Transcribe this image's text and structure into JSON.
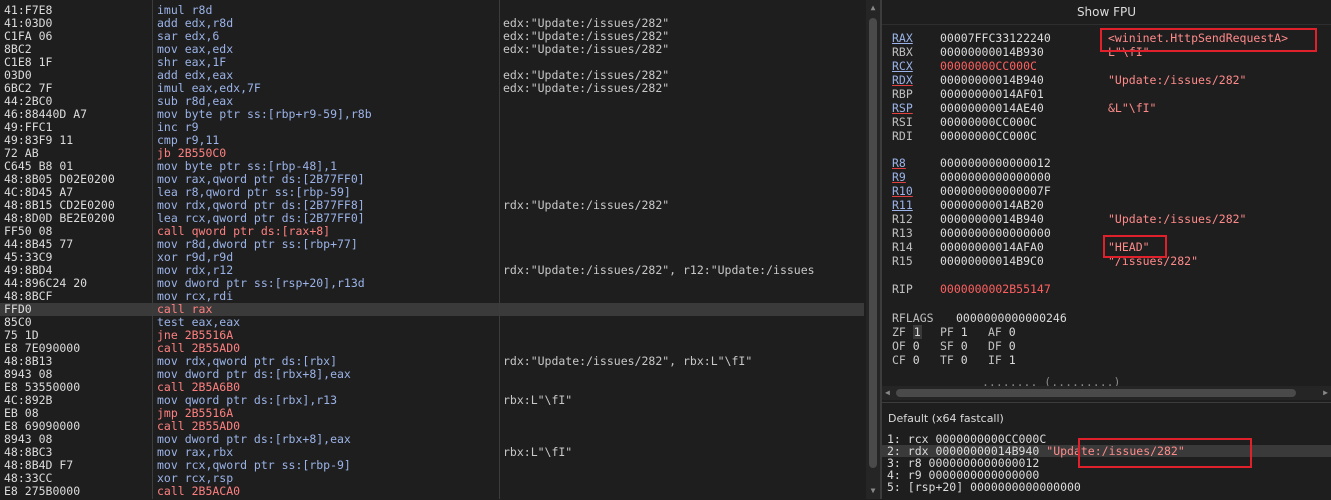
{
  "disasm": {
    "rows": [
      {
        "bytes": "41:F7E8",
        "instr": "imul r8d",
        "cls": "c-arith",
        "cmt": ""
      },
      {
        "bytes": "41:03D0",
        "instr": "add edx,r8d",
        "cls": "c-arith",
        "cmt": "edx:\"Update:/issues/282\""
      },
      {
        "bytes": "C1FA 06",
        "instr": "sar edx,6",
        "cls": "c-arith",
        "cmt": "edx:\"Update:/issues/282\""
      },
      {
        "bytes": "8BC2",
        "instr": "mov eax,edx",
        "cls": "c-mov",
        "cmt": "edx:\"Update:/issues/282\""
      },
      {
        "bytes": "C1E8 1F",
        "instr": "shr eax,1F",
        "cls": "c-arith",
        "cmt": ""
      },
      {
        "bytes": "03D0",
        "instr": "add edx,eax",
        "cls": "c-arith",
        "cmt": "edx:\"Update:/issues/282\""
      },
      {
        "bytes": "6BC2 7F",
        "instr": "imul eax,edx,7F",
        "cls": "c-arith",
        "cmt": "edx:\"Update:/issues/282\""
      },
      {
        "bytes": "44:2BC0",
        "instr": "sub r8d,eax",
        "cls": "c-arith",
        "cmt": ""
      },
      {
        "bytes": "46:88440D A7",
        "instr": "mov byte ptr ss:[rbp+r9-59],r8b",
        "cls": "c-mov",
        "cmt": ""
      },
      {
        "bytes": "49:FFC1",
        "instr": "inc r9",
        "cls": "c-arith",
        "cmt": ""
      },
      {
        "bytes": "49:83F9 11",
        "instr": "cmp r9,11",
        "cls": "c-cmp",
        "cmt": ""
      },
      {
        "bytes": "72 AB",
        "instr": "jb 2B550C0",
        "cls": "c-jmp",
        "cmt": ""
      },
      {
        "bytes": "C645 B8 01",
        "instr": "mov byte ptr ss:[rbp-48],1",
        "cls": "c-mov",
        "cmt": ""
      },
      {
        "bytes": "48:8B05 D02E0200",
        "instr": "mov rax,qword ptr ds:[2B77FF0]",
        "cls": "c-mov",
        "cmt": ""
      },
      {
        "bytes": "4C:8D45 A7",
        "instr": "lea r8,qword ptr ss:[rbp-59]",
        "cls": "c-mov",
        "cmt": ""
      },
      {
        "bytes": "48:8B15 CD2E0200",
        "instr": "mov rdx,qword ptr ds:[2B77FF8]",
        "cls": "c-mov",
        "cmt": "rdx:\"Update:/issues/282\""
      },
      {
        "bytes": "48:8D0D BE2E0200",
        "instr": "lea rcx,qword ptr ds:[2B77FF0]",
        "cls": "c-mov",
        "cmt": ""
      },
      {
        "bytes": "FF50 08",
        "instr": "call qword ptr ds:[rax+8]",
        "cls": "c-call",
        "cmt": ""
      },
      {
        "bytes": "44:8B45 77",
        "instr": "mov r8d,dword ptr ss:[rbp+77]",
        "cls": "c-mov",
        "cmt": ""
      },
      {
        "bytes": "45:33C9",
        "instr": "xor r9d,r9d",
        "cls": "c-arith",
        "cmt": ""
      },
      {
        "bytes": "49:8BD4",
        "instr": "mov rdx,r12",
        "cls": "c-mov",
        "cmt": "rdx:\"Update:/issues/282\", r12:\"Update:/issues"
      },
      {
        "bytes": "44:896C24 20",
        "instr": "mov dword ptr ss:[rsp+20],r13d",
        "cls": "c-mov",
        "cmt": ""
      },
      {
        "bytes": "48:8BCF",
        "instr": "mov rcx,rdi",
        "cls": "c-mov",
        "cmt": ""
      },
      {
        "bytes": "FFD0",
        "instr": "call rax",
        "cls": "c-call",
        "cmt": "",
        "hl": true
      },
      {
        "bytes": "85C0",
        "instr": "test eax,eax",
        "cls": "c-cmp",
        "cmt": ""
      },
      {
        "bytes": "75 1D",
        "instr": "jne 2B5516A",
        "cls": "c-jmp",
        "cmt": ""
      },
      {
        "bytes": "E8 7E090000",
        "instr": "call 2B55AD0",
        "cls": "c-call",
        "cmt": ""
      },
      {
        "bytes": "48:8B13",
        "instr": "mov rdx,qword ptr ds:[rbx]",
        "cls": "c-mov",
        "cmt": "rdx:\"Update:/issues/282\", rbx:L\"\\fI\""
      },
      {
        "bytes": "8943 08",
        "instr": "mov dword ptr ds:[rbx+8],eax",
        "cls": "c-mov",
        "cmt": ""
      },
      {
        "bytes": "E8 53550000",
        "instr": "call 2B5A6B0",
        "cls": "c-call",
        "cmt": ""
      },
      {
        "bytes": "4C:892B",
        "instr": "mov qword ptr ds:[rbx],r13",
        "cls": "c-mov",
        "cmt": "rbx:L\"\\fI\""
      },
      {
        "bytes": "EB 08",
        "instr": "jmp 2B5516A",
        "cls": "c-jmp",
        "cmt": ""
      },
      {
        "bytes": "E8 69090000",
        "instr": "call 2B55AD0",
        "cls": "c-call",
        "cmt": ""
      },
      {
        "bytes": "8943 08",
        "instr": "mov dword ptr ds:[rbx+8],eax",
        "cls": "c-mov",
        "cmt": ""
      },
      {
        "bytes": "48:8BC3",
        "instr": "mov rax,rbx",
        "cls": "c-mov",
        "cmt": "rbx:L\"\\fI\""
      },
      {
        "bytes": "48:8B4D F7",
        "instr": "mov rcx,qword ptr ss:[rbp-9]",
        "cls": "c-mov",
        "cmt": ""
      },
      {
        "bytes": "48:33CC",
        "instr": "xor rcx,rsp",
        "cls": "c-arith",
        "cmt": ""
      },
      {
        "bytes": "E8 275B0000",
        "instr": "call 2B5ACA0",
        "cls": "c-call",
        "cmt": ""
      }
    ]
  },
  "registers": {
    "show_fpu_label": "Show FPU",
    "gp": [
      {
        "name": "RAX",
        "value": "00007FFC33122240",
        "info": "<wininet.HttpSendRequestA>",
        "style": "u",
        "val_red": false
      },
      {
        "name": "RBX",
        "value": "00000000014B930",
        "info": "L\"\\fI\"",
        "style": "",
        "val_red": false
      },
      {
        "name": "RCX",
        "value": "00000000CC000C",
        "info": "",
        "style": "u",
        "val_red": true
      },
      {
        "name": "RDX",
        "value": "00000000014B940",
        "info": "\"Update:/issues/282\"",
        "style": "ur",
        "val_red": false
      },
      {
        "name": "RBP",
        "value": "00000000014AF01",
        "info": "",
        "style": "",
        "val_red": false
      },
      {
        "name": "RSP",
        "value": "00000000014AE40",
        "info": "&L\"\\fI\"",
        "style": "ur",
        "val_red": false
      },
      {
        "name": "RSI",
        "value": "00000000CC000C",
        "info": "",
        "style": "",
        "val_red": false
      },
      {
        "name": "RDI",
        "value": "00000000CC000C",
        "info": "",
        "style": "",
        "val_red": false
      }
    ],
    "ext": [
      {
        "name": "R8",
        "value": "0000000000000012",
        "info": "",
        "style": "ur",
        "val_red": false
      },
      {
        "name": "R9",
        "value": "0000000000000000",
        "info": "",
        "style": "ur",
        "val_red": false
      },
      {
        "name": "R10",
        "value": "000000000000007F",
        "info": "",
        "style": "ur",
        "val_red": false
      },
      {
        "name": "R11",
        "value": "00000000014AB20",
        "info": "",
        "style": "u",
        "val_red": false
      },
      {
        "name": "R12",
        "value": "00000000014B940",
        "info": "\"Update:/issues/282\"",
        "style": "",
        "val_red": false
      },
      {
        "name": "R13",
        "value": "0000000000000000",
        "info": "",
        "style": "",
        "val_red": false
      },
      {
        "name": "R14",
        "value": "00000000014AFA0",
        "info": "\"HEAD\"",
        "style": "",
        "val_red": false
      },
      {
        "name": "R15",
        "value": "00000000014B9C0",
        "info": "\"/issues/282\"",
        "style": "",
        "val_red": false
      }
    ],
    "rip": {
      "name": "RIP",
      "value": "0000000002B55147",
      "val_red": true
    },
    "rflags": {
      "name": "RFLAGS",
      "value": "0000000000000246"
    },
    "flags": [
      [
        {
          "n": "ZF",
          "v": "1",
          "box": true
        },
        {
          "n": "PF",
          "v": "1"
        },
        {
          "n": "AF",
          "v": "0"
        }
      ],
      [
        {
          "n": "OF",
          "v": "0"
        },
        {
          "n": "SF",
          "v": "0"
        },
        {
          "n": "DF",
          "v": "0"
        }
      ],
      [
        {
          "n": "CF",
          "v": "0"
        },
        {
          "n": "TF",
          "v": "0"
        },
        {
          "n": "IF",
          "v": "1"
        }
      ]
    ],
    "truncated": "........ (.........)"
  },
  "callstack": {
    "title": "Default (x64 fastcall)",
    "rows": [
      {
        "text": "1: rcx 0000000000CC000C",
        "info": ""
      },
      {
        "text": "2: rdx 00000000014B940",
        "info": "\"Update:/issues/282\"",
        "hl": true
      },
      {
        "text": "3: r8 0000000000000012",
        "info": ""
      },
      {
        "text": "4: r9 0000000000000000",
        "info": ""
      },
      {
        "text": "5: [rsp+20] 0000000000000000",
        "info": ""
      }
    ]
  }
}
